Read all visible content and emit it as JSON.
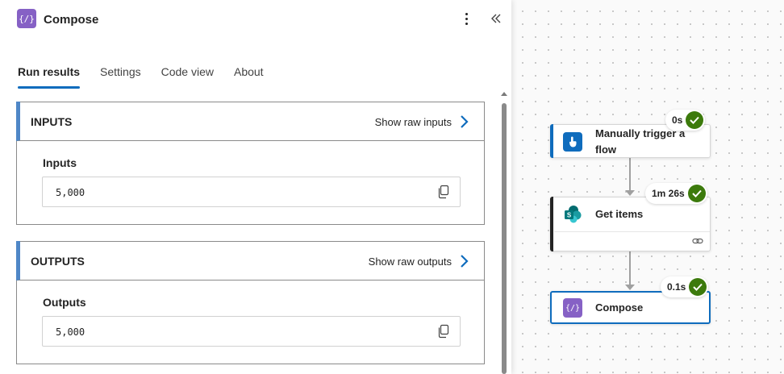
{
  "panel": {
    "title": "Compose",
    "icon": "compose-icon",
    "badge_color": "#8661c5",
    "tabs": [
      {
        "label": "Run results",
        "active": true
      },
      {
        "label": "Settings",
        "active": false
      },
      {
        "label": "Code view",
        "active": false
      },
      {
        "label": "About",
        "active": false
      }
    ],
    "inputs": {
      "heading": "INPUTS",
      "raw_link": "Show raw inputs",
      "field_label": "Inputs",
      "field_value": "5,000"
    },
    "outputs": {
      "heading": "OUTPUTS",
      "raw_link": "Show raw outputs",
      "field_label": "Outputs",
      "field_value": "5,000"
    }
  },
  "flow": {
    "nodes": [
      {
        "label": "Manually trigger a flow",
        "duration": "0s",
        "status": "succeeded",
        "icon": "hand-touch-icon",
        "accent": "#0f6cbd"
      },
      {
        "label": "Get items",
        "duration": "1m 26s",
        "status": "succeeded",
        "icon": "sharepoint-icon",
        "accent": "#242424"
      },
      {
        "label": "Compose",
        "duration": "0.1s",
        "status": "succeeded",
        "icon": "compose-icon",
        "accent": "#0f6cbd"
      }
    ],
    "success_color": "#3c7a0c"
  }
}
